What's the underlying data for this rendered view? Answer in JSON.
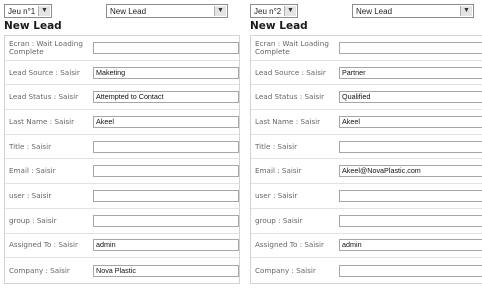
{
  "panels": [
    {
      "game_select": "Jeu n°1",
      "lead_select": "New Lead",
      "title": "New Lead",
      "fields": [
        {
          "label": "Ecran : Wait Loading Complete",
          "value": ""
        },
        {
          "label": "Lead Source : Saisir",
          "value": "Maketing"
        },
        {
          "label": "Lead Status : Saisir",
          "value": "Attempted to Contact"
        },
        {
          "label": "Last Name : Saisir",
          "value": "Akeel"
        },
        {
          "label": "Title : Saisir",
          "value": ""
        },
        {
          "label": "Email : Saisir",
          "value": ""
        },
        {
          "label": "user : Saisir",
          "value": ""
        },
        {
          "label": "group : Saisir",
          "value": ""
        },
        {
          "label": "Assigned To : Saisir",
          "value": "admin"
        },
        {
          "label": "Company : Saisir",
          "value": "Nova Plastic"
        }
      ]
    },
    {
      "game_select": "Jeu n°2",
      "lead_select": "New Lead",
      "title": "New Lead",
      "fields": [
        {
          "label": "Ecran : Wait Loading Complete",
          "value": ""
        },
        {
          "label": "Lead Source : Saisir",
          "value": "Partner"
        },
        {
          "label": "Lead Status : Saisir",
          "value": "Qualified"
        },
        {
          "label": "Last Name : Saisir",
          "value": "Akeel"
        },
        {
          "label": "Title : Saisir",
          "value": ""
        },
        {
          "label": "Email : Saisir",
          "value": "Akeel@NovaPlastic.com"
        },
        {
          "label": "user : Saisir",
          "value": ""
        },
        {
          "label": "group : Saisir",
          "value": ""
        },
        {
          "label": "Assigned To : Saisir",
          "value": "admin"
        },
        {
          "label": "Company : Saisir",
          "value": ""
        }
      ]
    }
  ]
}
